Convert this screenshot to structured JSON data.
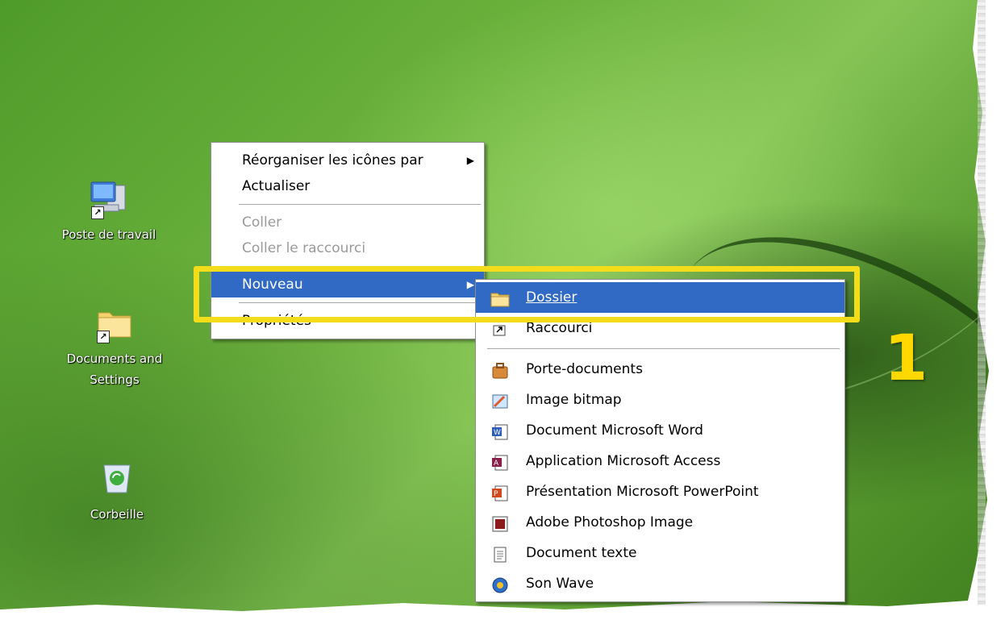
{
  "desktop": {
    "icons": [
      {
        "label": "Poste de travail",
        "icon": "computer-icon"
      },
      {
        "label": "Documents and Settings",
        "icon": "folder-icon"
      },
      {
        "label": "Corbeille",
        "icon": "recycle-bin-icon"
      }
    ]
  },
  "context_menu": {
    "items": [
      {
        "label": "Réorganiser les icônes par",
        "has_submenu": true
      },
      {
        "label": "Actualiser"
      },
      {
        "label": "Coller",
        "disabled": true
      },
      {
        "label": "Coller le raccourci",
        "disabled": true
      },
      {
        "label": "Nouveau",
        "has_submenu": true,
        "selected": true
      },
      {
        "label": "Propriétés"
      }
    ]
  },
  "new_submenu": {
    "items": [
      {
        "label": "Dossier",
        "icon": "folder-icon",
        "selected": true
      },
      {
        "label": "Raccourci",
        "icon": "shortcut-icon"
      },
      {
        "label": "Porte-documents",
        "icon": "briefcase-icon"
      },
      {
        "label": "Image bitmap",
        "icon": "paint-icon"
      },
      {
        "label": "Document Microsoft Word",
        "icon": "word-icon"
      },
      {
        "label": "Application Microsoft Access",
        "icon": "access-icon"
      },
      {
        "label": "Présentation Microsoft PowerPoint",
        "icon": "powerpoint-icon"
      },
      {
        "label": "Adobe Photoshop Image",
        "icon": "photoshop-icon"
      },
      {
        "label": "Document texte",
        "icon": "text-document-icon"
      },
      {
        "label": "Son Wave",
        "icon": "wave-sound-icon"
      }
    ]
  },
  "annotation": {
    "step_number": "1",
    "highlight_color": "#f3dc1a"
  },
  "colors": {
    "selection": "#316ac5",
    "number": "#ffd800"
  }
}
